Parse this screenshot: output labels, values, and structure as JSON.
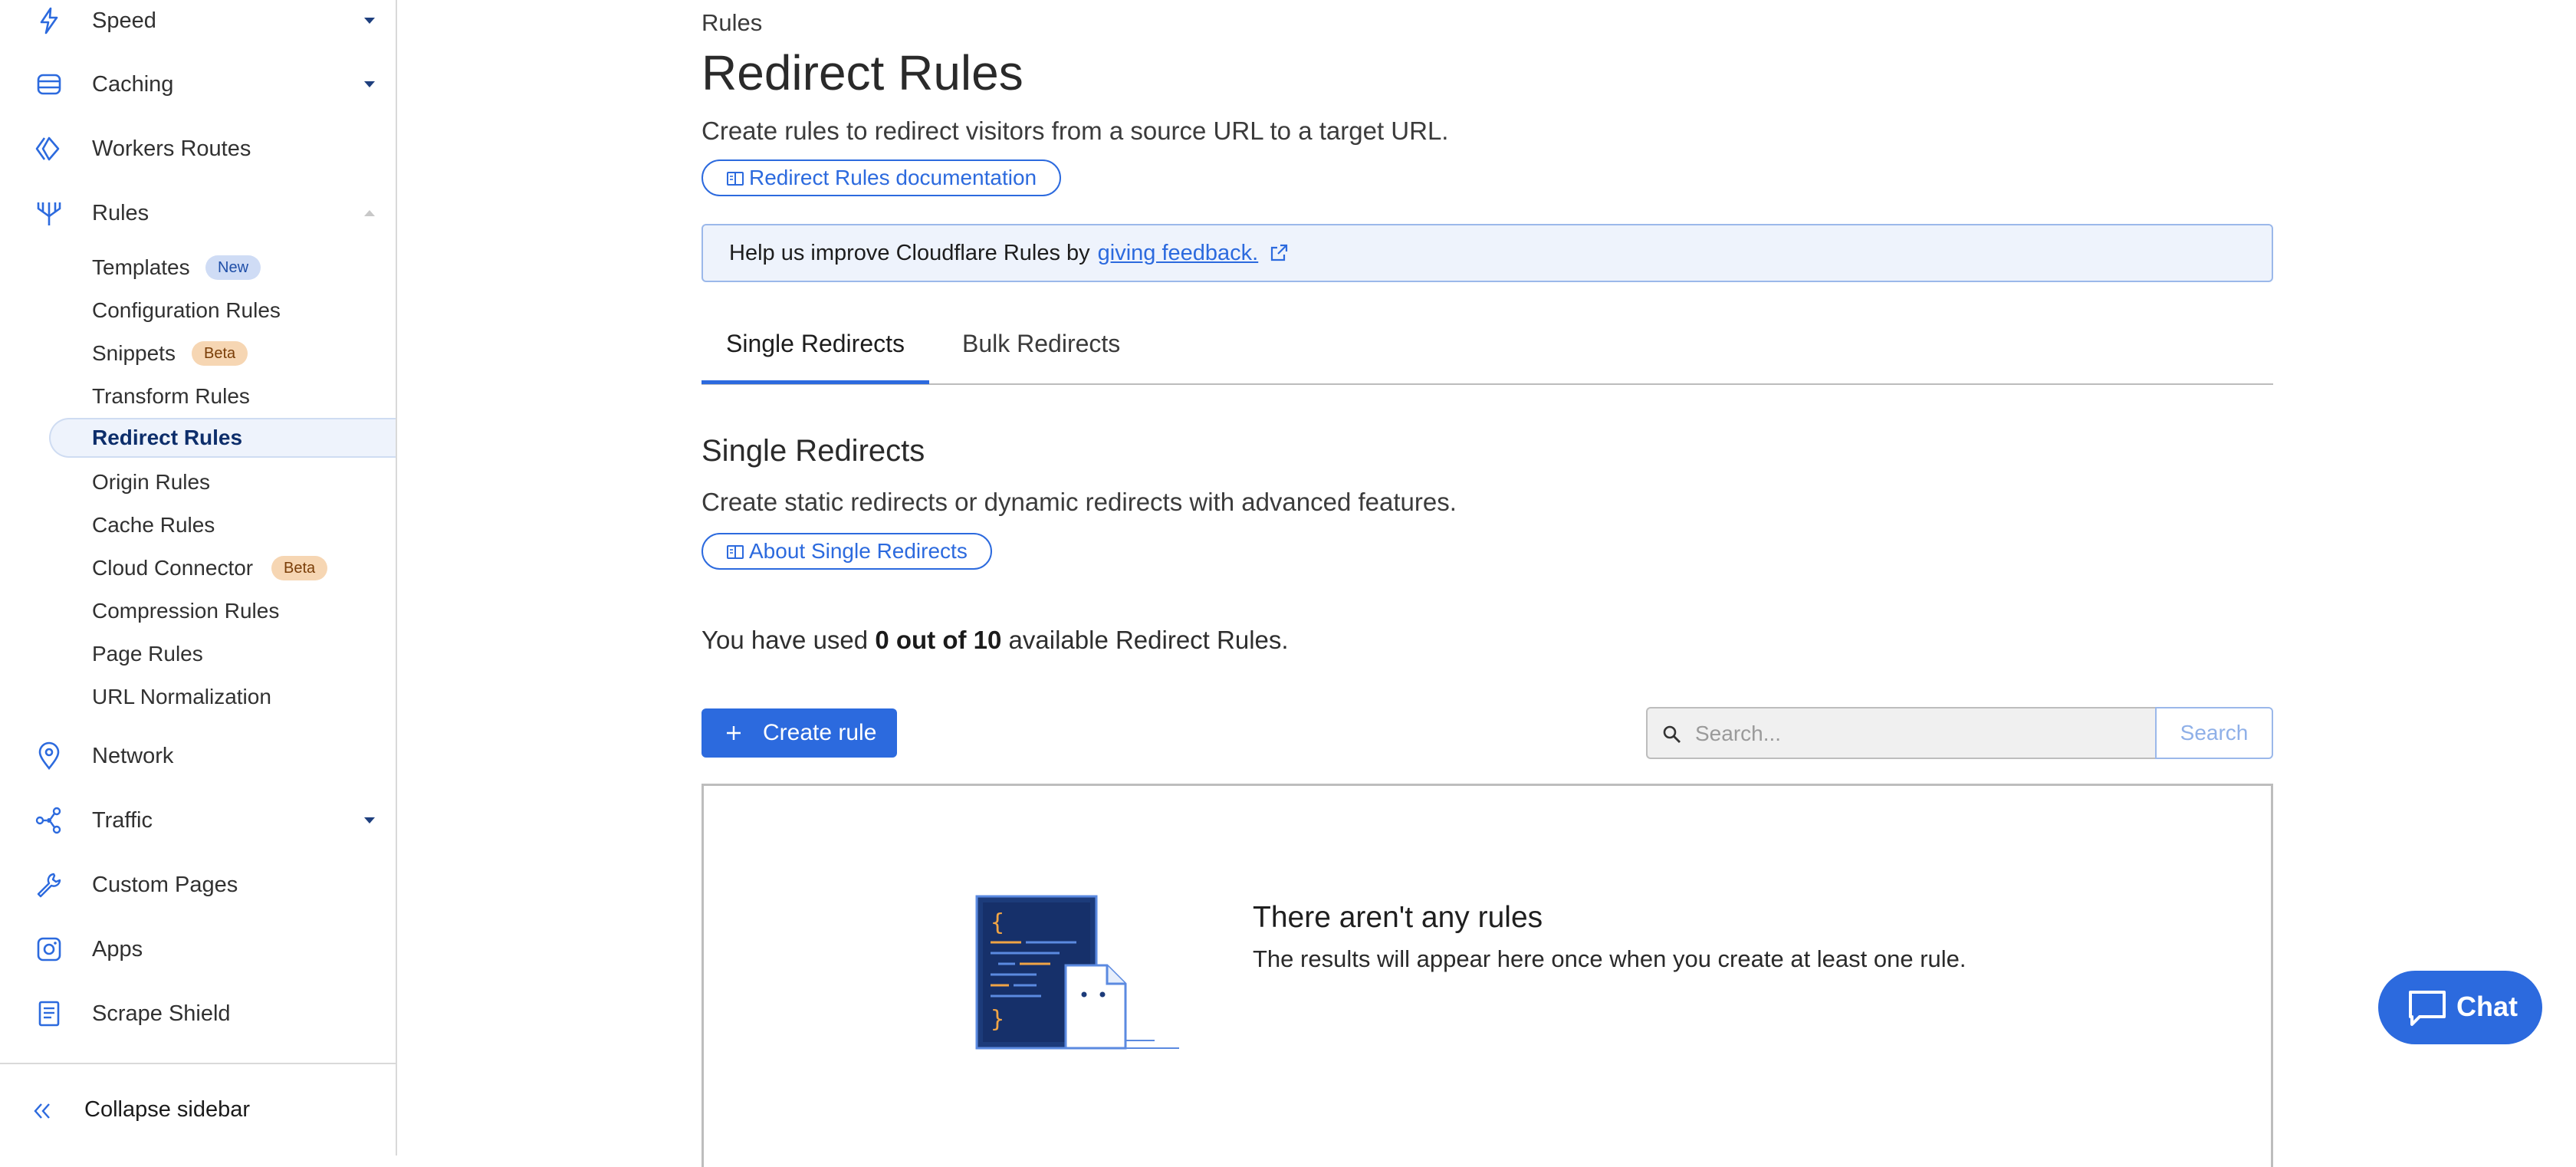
{
  "sidebar": {
    "items": [
      {
        "label": "Speed",
        "icon": "lightning-icon"
      },
      {
        "label": "Caching",
        "icon": "database-icon"
      },
      {
        "label": "Workers Routes",
        "icon": "workers-icon"
      },
      {
        "label": "Rules",
        "icon": "rules-funnel-icon"
      },
      {
        "label": "Network",
        "icon": "location-pin-icon"
      },
      {
        "label": "Traffic",
        "icon": "traffic-nodes-icon"
      },
      {
        "label": "Custom Pages",
        "icon": "wrench-icon"
      },
      {
        "label": "Apps",
        "icon": "apps-icon"
      },
      {
        "label": "Scrape Shield",
        "icon": "document-icon"
      }
    ],
    "rules_subitems": [
      {
        "label": "Templates",
        "badge": "New"
      },
      {
        "label": "Configuration Rules"
      },
      {
        "label": "Snippets",
        "badge": "Beta"
      },
      {
        "label": "Transform Rules"
      },
      {
        "label": "Redirect Rules",
        "active": true
      },
      {
        "label": "Origin Rules"
      },
      {
        "label": "Cache Rules"
      },
      {
        "label": "Cloud Connector",
        "badge": "Beta"
      },
      {
        "label": "Compression Rules"
      },
      {
        "label": "Page Rules"
      },
      {
        "label": "URL Normalization"
      }
    ],
    "collapse_label": "Collapse sidebar"
  },
  "main": {
    "breadcrumb": "Rules",
    "title": "Redirect Rules",
    "subtitle": "Create rules to redirect visitors from a source URL to a target URL.",
    "docs_button": "Redirect Rules documentation",
    "feedback": {
      "text": "Help us improve Cloudflare Rules by",
      "link": "giving feedback."
    },
    "tabs": [
      {
        "label": "Single Redirects",
        "active": true
      },
      {
        "label": "Bulk Redirects"
      }
    ],
    "section_title": "Single Redirects",
    "section_desc": "Create static redirects or dynamic redirects with advanced features.",
    "about_button": "About Single Redirects",
    "usage": {
      "prefix": "You have used",
      "count": "0 out of 10",
      "suffix": "available Redirect Rules."
    },
    "create_button": "Create rule",
    "search": {
      "placeholder": "Search...",
      "button": "Search"
    },
    "empty": {
      "title": "There aren't any rules",
      "desc": "The results will appear here once when you create at least one rule."
    }
  },
  "chat": {
    "label": "Chat"
  },
  "colors": {
    "accent": "#2c6ade",
    "active_bg": "#eef3fc",
    "beta_badge": "#f6d6b3",
    "new_badge": "#cfdcf5"
  }
}
